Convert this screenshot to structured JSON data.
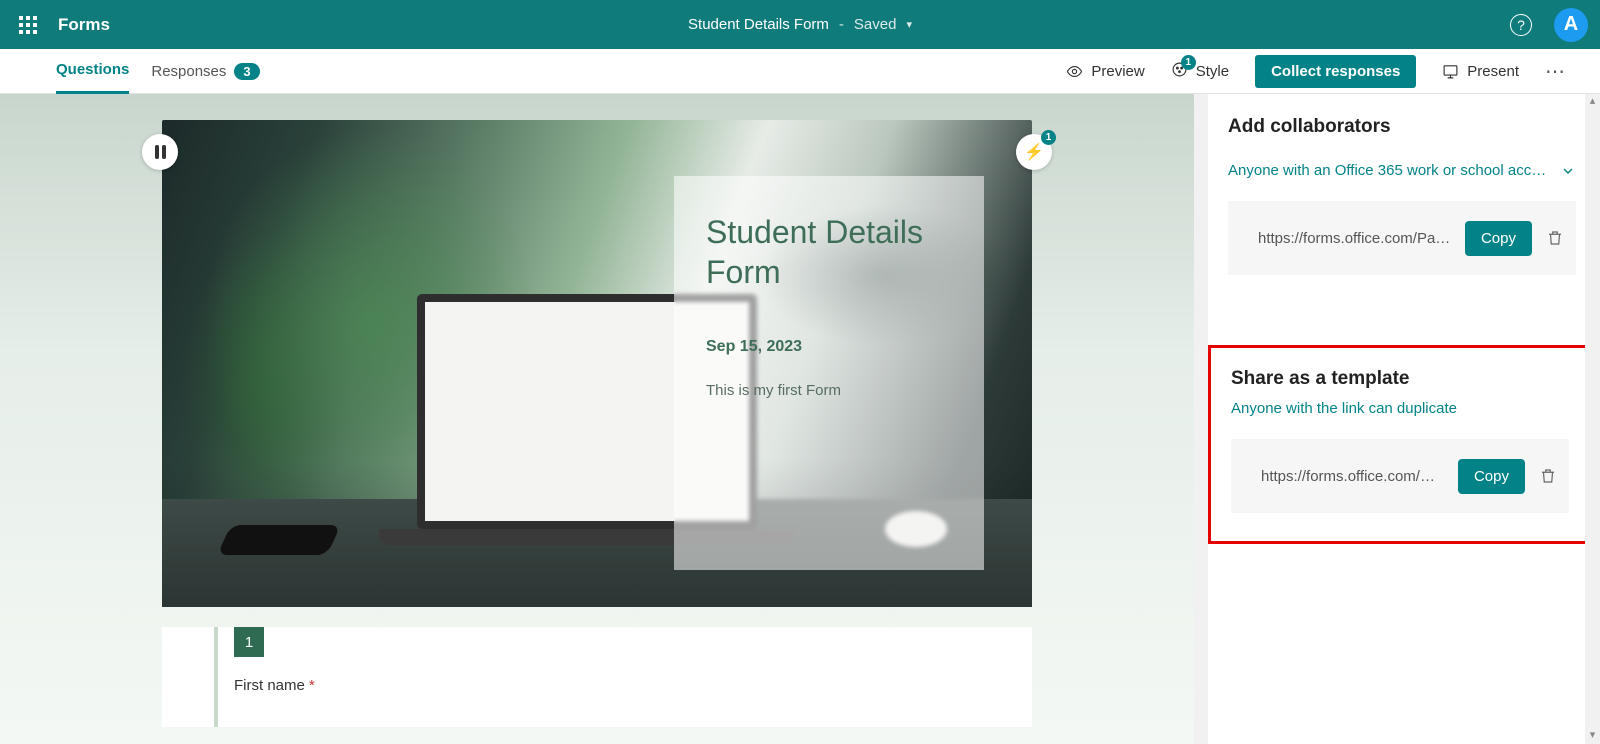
{
  "header": {
    "app_name": "Forms",
    "form_title": "Student Details Form",
    "sep": "-",
    "saved": "Saved",
    "avatar_initial": "A"
  },
  "toolbar": {
    "tabs": {
      "questions": "Questions",
      "responses": "Responses",
      "responses_count": "3"
    },
    "preview": "Preview",
    "style": "Style",
    "style_badge": "1",
    "collect": "Collect responses",
    "present": "Present"
  },
  "hero": {
    "title": "Student Details Form",
    "date": "Sep 15, 2023",
    "desc": "This is my first Form",
    "bolt_badge": "1"
  },
  "question1": {
    "num": "1",
    "label": "First name"
  },
  "sidebar": {
    "collab_title": "Add collaborators",
    "collab_dropdown": "Anyone with an Office 365 work or school acco...",
    "collab_link": "https://forms.office.com/Pag...",
    "copy": "Copy",
    "template_title": "Share as a template",
    "template_sub": "Anyone with the link can duplicate",
    "template_link": "https://forms.office.com/Pag..."
  }
}
